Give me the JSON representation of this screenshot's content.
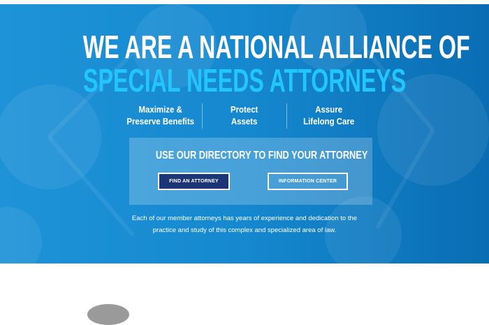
{
  "hero": {
    "title_line1": "WE ARE A NATIONAL ALLIANCE OF",
    "title_line2": "SPECIAL NEEDS ATTORNEYS",
    "features": [
      {
        "line1": "Maximize &",
        "line2": "Preserve Benefits"
      },
      {
        "line1": "Protect",
        "line2": "Assets"
      },
      {
        "line1": "Assure",
        "line2": "Lifelong Care"
      }
    ],
    "directory": {
      "title": "USE OUR DIRECTORY TO FIND YOUR ATTORNEY",
      "find_button": "FIND AN ATTORNEY",
      "info_button": "INFORMATION CENTER"
    },
    "description_line1": "Each of our member attorneys has years of experience and dedication to the",
    "description_line2": "practice and study of this complex and specialized area of law."
  },
  "colors": {
    "hero_bg": "#1588cf",
    "accent_cyan": "#22c6ff",
    "button_navy": "#1b3577"
  }
}
